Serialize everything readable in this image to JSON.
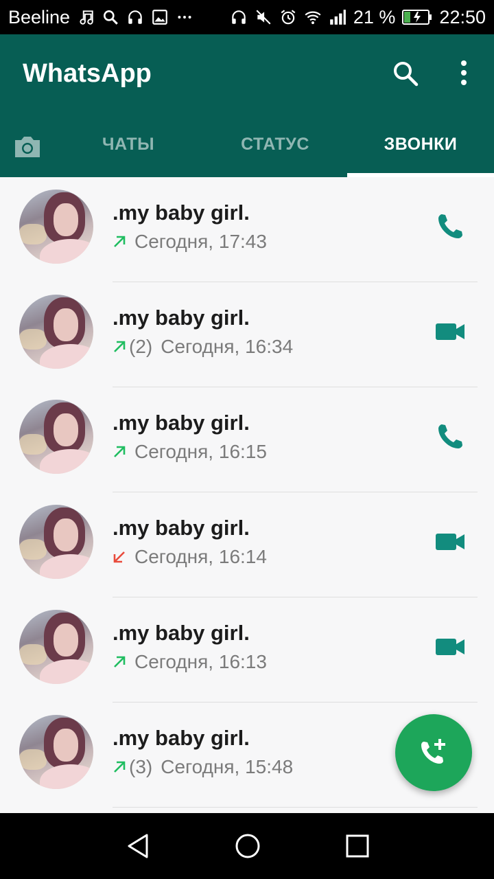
{
  "status_bar": {
    "carrier": "Beeline",
    "battery_percent": "21 %",
    "time": "22:50"
  },
  "app_bar": {
    "title": "WhatsApp",
    "tabs": [
      {
        "label": "ЧАТЫ",
        "active": false
      },
      {
        "label": "СТАТУС",
        "active": false
      },
      {
        "label": "ЗВОНКИ",
        "active": true
      }
    ]
  },
  "calls": [
    {
      "name": ".my baby girl.",
      "direction": "outgoing",
      "count": "",
      "time": "Сегодня, 17:43",
      "type": "voice"
    },
    {
      "name": ".my baby girl.",
      "direction": "outgoing",
      "count": "(2)",
      "time": "Сегодня, 16:34",
      "type": "video"
    },
    {
      "name": ".my baby girl.",
      "direction": "outgoing",
      "count": "",
      "time": "Сегодня, 16:15",
      "type": "voice"
    },
    {
      "name": ".my baby girl.",
      "direction": "missed",
      "count": "",
      "time": "Сегодня, 16:14",
      "type": "video"
    },
    {
      "name": ".my baby girl.",
      "direction": "outgoing",
      "count": "",
      "time": "Сегодня, 16:13",
      "type": "video"
    },
    {
      "name": ".my baby girl.",
      "direction": "outgoing",
      "count": "(3)",
      "time": "Сегодня, 15:48",
      "type": "video"
    }
  ],
  "colors": {
    "header": "#075e54",
    "accent_teal": "#128c7e",
    "fab": "#1da65a",
    "outgoing_arrow": "#1fbd60",
    "missed_arrow": "#e94b3c"
  },
  "icons": {
    "fab": "add-call-icon",
    "search": "search-icon",
    "more": "more-vert-icon",
    "camera": "camera-icon"
  }
}
